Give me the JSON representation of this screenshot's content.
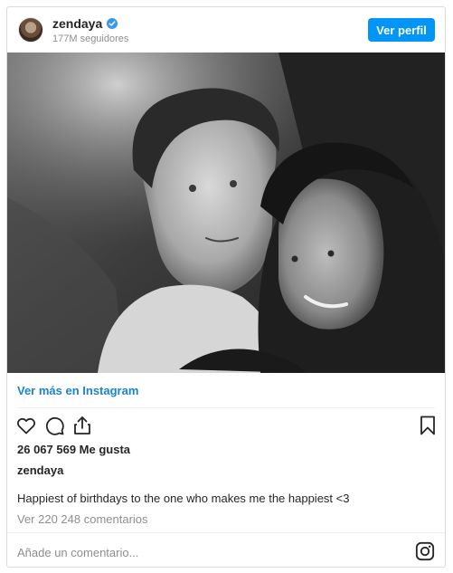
{
  "header": {
    "username": "zendaya",
    "followers": "177M seguidores",
    "profile_button": "Ver perfil"
  },
  "post": {
    "image_alt": "Black and white photo",
    "more_link": "Ver más en Instagram",
    "likes": "26 067 569 Me gusta",
    "owner": "zendaya",
    "caption": "Happiest of birthdays to the one who makes me the happiest <3",
    "comments_link": "Ver 220 248 comentarios"
  },
  "comment_box": {
    "placeholder": "Añade un comentario..."
  },
  "icons": {
    "verified": "verified-badge-icon",
    "like": "heart-icon",
    "comment": "comment-icon",
    "share": "share-icon",
    "save": "bookmark-icon",
    "instagram": "instagram-icon"
  },
  "colors": {
    "accent": "#0095f6",
    "link": "#1a82d0",
    "muted": "#8e8e8e",
    "text": "#262626"
  }
}
